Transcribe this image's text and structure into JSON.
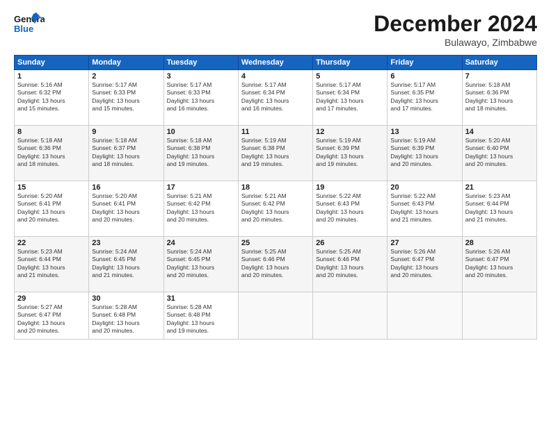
{
  "header": {
    "logo_general": "General",
    "logo_blue": "Blue",
    "title": "December 2024",
    "subtitle": "Bulawayo, Zimbabwe"
  },
  "weekdays": [
    "Sunday",
    "Monday",
    "Tuesday",
    "Wednesday",
    "Thursday",
    "Friday",
    "Saturday"
  ],
  "weeks": [
    [
      {
        "day": "1",
        "sunrise": "5:16 AM",
        "sunset": "6:32 PM",
        "daylight": "13 hours and 15 minutes."
      },
      {
        "day": "2",
        "sunrise": "5:17 AM",
        "sunset": "6:33 PM",
        "daylight": "13 hours and 15 minutes."
      },
      {
        "day": "3",
        "sunrise": "5:17 AM",
        "sunset": "6:33 PM",
        "daylight": "13 hours and 16 minutes."
      },
      {
        "day": "4",
        "sunrise": "5:17 AM",
        "sunset": "6:34 PM",
        "daylight": "13 hours and 16 minutes."
      },
      {
        "day": "5",
        "sunrise": "5:17 AM",
        "sunset": "6:34 PM",
        "daylight": "13 hours and 17 minutes."
      },
      {
        "day": "6",
        "sunrise": "5:17 AM",
        "sunset": "6:35 PM",
        "daylight": "13 hours and 17 minutes."
      },
      {
        "day": "7",
        "sunrise": "5:18 AM",
        "sunset": "6:36 PM",
        "daylight": "13 hours and 18 minutes."
      }
    ],
    [
      {
        "day": "8",
        "sunrise": "5:18 AM",
        "sunset": "6:36 PM",
        "daylight": "13 hours and 18 minutes."
      },
      {
        "day": "9",
        "sunrise": "5:18 AM",
        "sunset": "6:37 PM",
        "daylight": "13 hours and 18 minutes."
      },
      {
        "day": "10",
        "sunrise": "5:18 AM",
        "sunset": "6:38 PM",
        "daylight": "13 hours and 19 minutes."
      },
      {
        "day": "11",
        "sunrise": "5:19 AM",
        "sunset": "6:38 PM",
        "daylight": "13 hours and 19 minutes."
      },
      {
        "day": "12",
        "sunrise": "5:19 AM",
        "sunset": "6:39 PM",
        "daylight": "13 hours and 19 minutes."
      },
      {
        "day": "13",
        "sunrise": "5:19 AM",
        "sunset": "6:39 PM",
        "daylight": "13 hours and 20 minutes."
      },
      {
        "day": "14",
        "sunrise": "5:20 AM",
        "sunset": "6:40 PM",
        "daylight": "13 hours and 20 minutes."
      }
    ],
    [
      {
        "day": "15",
        "sunrise": "5:20 AM",
        "sunset": "6:41 PM",
        "daylight": "13 hours and 20 minutes."
      },
      {
        "day": "16",
        "sunrise": "5:20 AM",
        "sunset": "6:41 PM",
        "daylight": "13 hours and 20 minutes."
      },
      {
        "day": "17",
        "sunrise": "5:21 AM",
        "sunset": "6:42 PM",
        "daylight": "13 hours and 20 minutes."
      },
      {
        "day": "18",
        "sunrise": "5:21 AM",
        "sunset": "6:42 PM",
        "daylight": "13 hours and 20 minutes."
      },
      {
        "day": "19",
        "sunrise": "5:22 AM",
        "sunset": "6:43 PM",
        "daylight": "13 hours and 20 minutes."
      },
      {
        "day": "20",
        "sunrise": "5:22 AM",
        "sunset": "6:43 PM",
        "daylight": "13 hours and 21 minutes."
      },
      {
        "day": "21",
        "sunrise": "5:23 AM",
        "sunset": "6:44 PM",
        "daylight": "13 hours and 21 minutes."
      }
    ],
    [
      {
        "day": "22",
        "sunrise": "5:23 AM",
        "sunset": "6:44 PM",
        "daylight": "13 hours and 21 minutes."
      },
      {
        "day": "23",
        "sunrise": "5:24 AM",
        "sunset": "6:45 PM",
        "daylight": "13 hours and 21 minutes."
      },
      {
        "day": "24",
        "sunrise": "5:24 AM",
        "sunset": "6:45 PM",
        "daylight": "13 hours and 20 minutes."
      },
      {
        "day": "25",
        "sunrise": "5:25 AM",
        "sunset": "6:46 PM",
        "daylight": "13 hours and 20 minutes."
      },
      {
        "day": "26",
        "sunrise": "5:25 AM",
        "sunset": "6:46 PM",
        "daylight": "13 hours and 20 minutes."
      },
      {
        "day": "27",
        "sunrise": "5:26 AM",
        "sunset": "6:47 PM",
        "daylight": "13 hours and 20 minutes."
      },
      {
        "day": "28",
        "sunrise": "5:26 AM",
        "sunset": "6:47 PM",
        "daylight": "13 hours and 20 minutes."
      }
    ],
    [
      {
        "day": "29",
        "sunrise": "5:27 AM",
        "sunset": "6:47 PM",
        "daylight": "13 hours and 20 minutes."
      },
      {
        "day": "30",
        "sunrise": "5:28 AM",
        "sunset": "6:48 PM",
        "daylight": "13 hours and 20 minutes."
      },
      {
        "day": "31",
        "sunrise": "5:28 AM",
        "sunset": "6:48 PM",
        "daylight": "13 hours and 19 minutes."
      },
      null,
      null,
      null,
      null
    ]
  ],
  "labels": {
    "sunrise": "Sunrise:",
    "sunset": "Sunset:",
    "daylight": "Daylight:"
  }
}
